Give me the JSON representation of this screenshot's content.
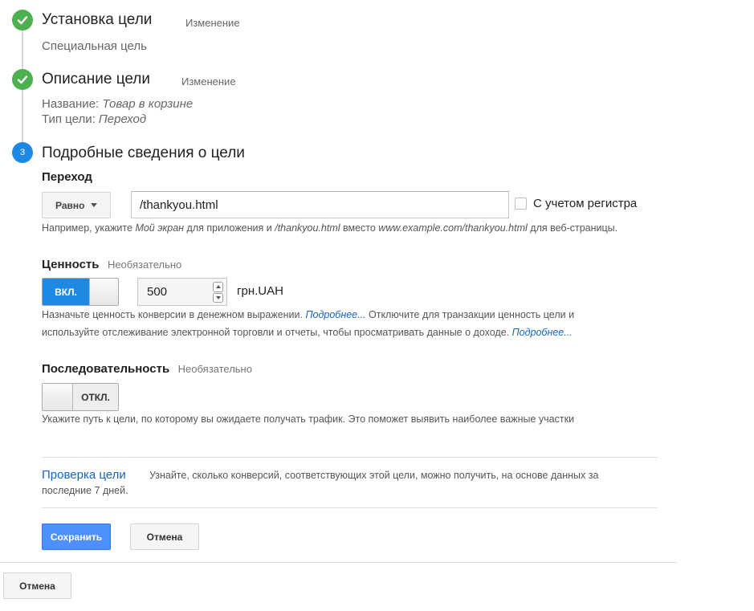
{
  "colors": {
    "done": "#4caf50",
    "current": "#1e88e5",
    "link": "#1565c0",
    "primary": "#4d90fe"
  },
  "steps": [
    {
      "icon": "check-icon",
      "title": "Установка цели",
      "edit": "Изменение",
      "summary": "Специальная цель"
    },
    {
      "icon": "check-icon",
      "title": "Описание цели",
      "edit": "Изменение",
      "name_label": "Название:",
      "name_value": "Товар в корзине",
      "type_label": "Тип цели:",
      "type_value": "Переход"
    },
    {
      "number": "3",
      "title": "Подробные сведения о цели"
    }
  ],
  "destination": {
    "label": "Переход",
    "match_type": "Равно",
    "value": "/thankyou.html",
    "case_sensitive_label": "С учетом регистра",
    "case_sensitive": false,
    "help": {
      "prefix": "Например, укажите ",
      "example_screen": "Мой экран",
      "mid1": " для приложения и ",
      "example_path": "/thankyou.html",
      "mid2": " вместо ",
      "example_url": "www.example.com/thankyou.html",
      "suffix": " для веб-страницы."
    }
  },
  "value_section": {
    "label": "Ценность",
    "optional": "Необязательно",
    "toggle_label": "ВКЛ.",
    "toggle_on": true,
    "amount": "500",
    "currency": "грн.UAH",
    "help_part1": "Назначьте ценность конверсии в денежном выражении. ",
    "more_link1": "Подробнее...",
    "help_part2": " Отключите для транзакции ценность цели и",
    "help_line2": "используйте отслеживание электронной торговли и отчеты, чтобы просматривать данные о доходе. ",
    "more_link2": "Подробнее..."
  },
  "funnel": {
    "label": "Последовательность",
    "optional": "Необязательно",
    "toggle_label": "ОТКЛ.",
    "toggle_on": false,
    "help": "Укажите путь к цели, по которому вы ожидаете получать трафик. Это поможет выявить наиболее важные участки"
  },
  "verify": {
    "link": "Проверка цели",
    "text_line1": "Узнайте, сколько конверсий, соответствующих этой цели, можно получить, на основе данных за",
    "text_line2": "последние 7 дней."
  },
  "buttons": {
    "save": "Сохранить",
    "cancel": "Отмена",
    "cancel_outer": "Отмена"
  }
}
